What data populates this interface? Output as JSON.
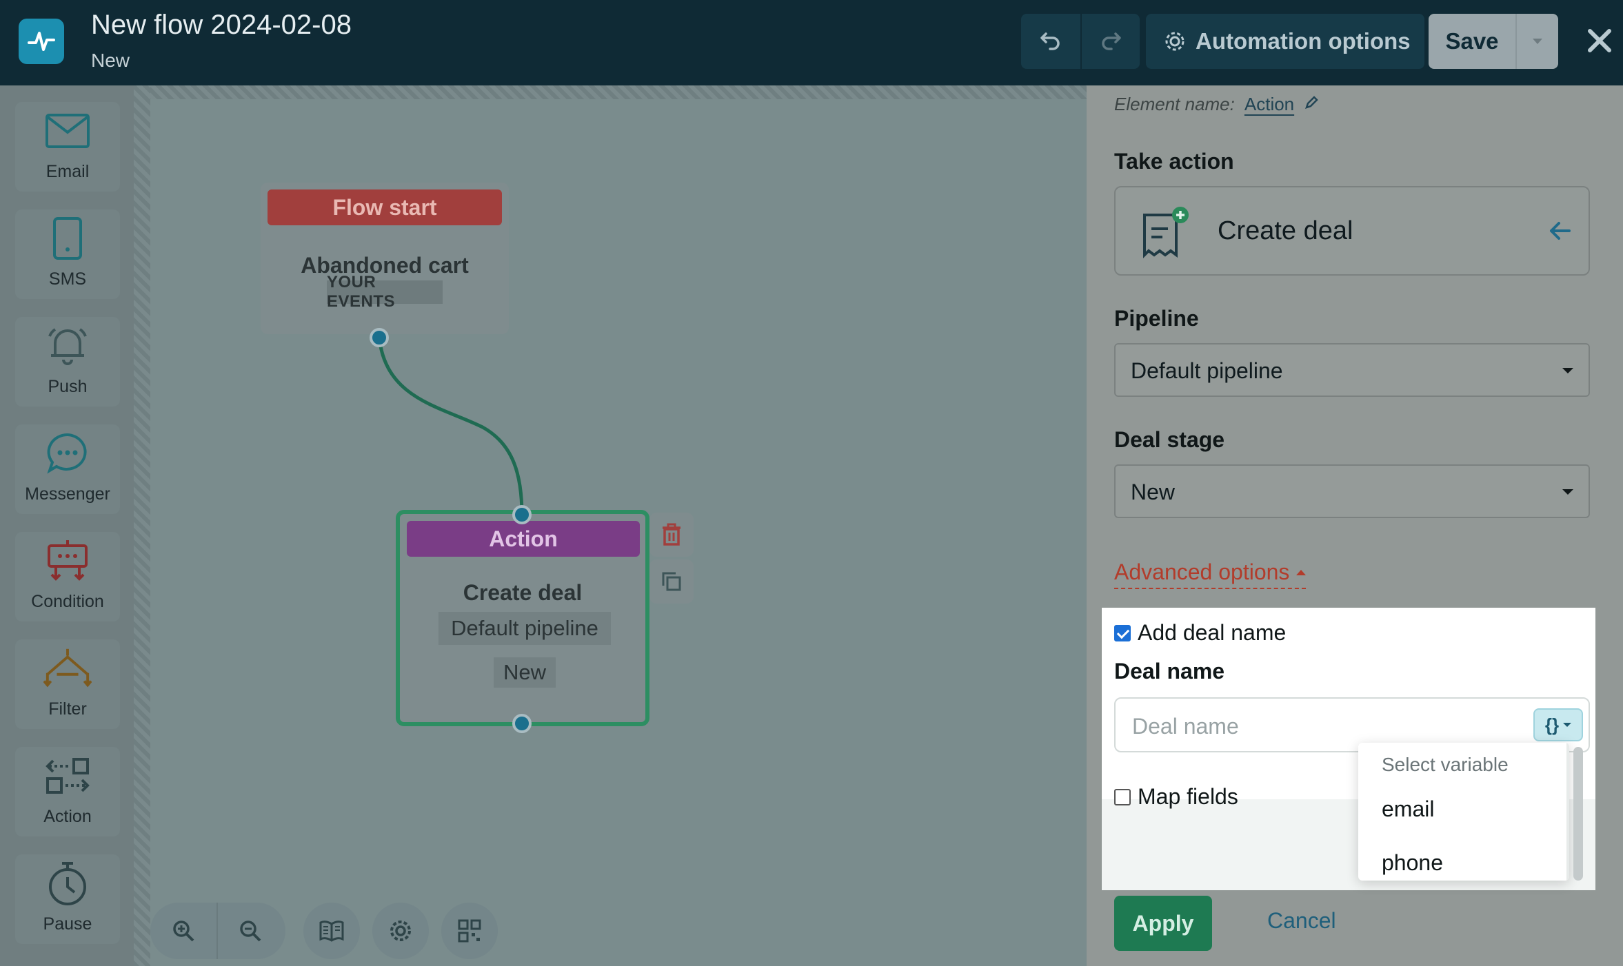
{
  "header": {
    "title": "New flow 2024-02-08",
    "status": "New",
    "automation_label": "Automation options",
    "save_label": "Save"
  },
  "palette": {
    "items": [
      {
        "label": "Email",
        "icon": "envelope-icon"
      },
      {
        "label": "SMS",
        "icon": "phone-icon"
      },
      {
        "label": "Push",
        "icon": "bell-icon"
      },
      {
        "label": "Messenger",
        "icon": "chat-bubble-icon"
      },
      {
        "label": "Condition",
        "icon": "condition-icon"
      },
      {
        "label": "Filter",
        "icon": "filter-icon"
      },
      {
        "label": "Action",
        "icon": "action-icon"
      },
      {
        "label": "Pause",
        "icon": "stopwatch-icon"
      }
    ]
  },
  "canvas": {
    "start_node": {
      "header": "Flow start",
      "title": "Abandoned cart",
      "tag": "YOUR EVENTS"
    },
    "action_node": {
      "header": "Action",
      "title": "Create deal",
      "pipeline": "Default pipeline",
      "stage": "New"
    }
  },
  "panel": {
    "element_name_label": "Element name:",
    "element_name_value": "Action",
    "take_action_label": "Take action",
    "action_card_text": "Create deal",
    "pipeline_label": "Pipeline",
    "pipeline_value": "Default pipeline",
    "deal_stage_label": "Deal stage",
    "deal_stage_value": "New",
    "advanced_label": "Advanced options",
    "add_deal_name_label": "Add deal name",
    "add_deal_name_checked": true,
    "deal_name_label": "Deal name",
    "deal_name_placeholder": "Deal name",
    "var_button_label": "{}",
    "map_fields_label": "Map fields",
    "map_fields_checked": false,
    "variable_menu": {
      "header": "Select variable",
      "items": [
        "email",
        "phone"
      ]
    },
    "apply_label": "Apply",
    "cancel_label": "Cancel"
  },
  "colors": {
    "header_bg": "#0f2a35",
    "flow_start": "#a13f3d",
    "action_header": "#7a3d86",
    "selected_border": "#2d8e62",
    "apply_button": "#1e7a52",
    "advanced_link": "#b23c2b",
    "checkbox_checked": "#1b6fd6"
  }
}
